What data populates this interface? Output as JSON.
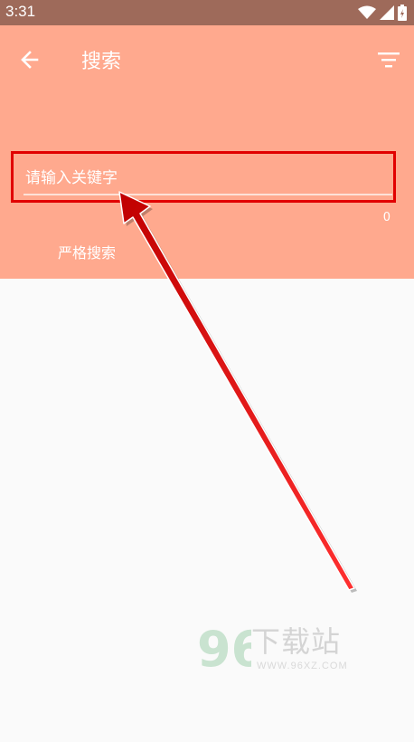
{
  "status_bar": {
    "time": "3:31",
    "icons": [
      "wifi-icon",
      "signal-icon",
      "battery-icon"
    ]
  },
  "header": {
    "title": "搜索",
    "back_icon": "arrow-left-icon",
    "filter_icon": "filter-icon"
  },
  "search": {
    "placeholder": "请输入关键字",
    "value": "",
    "char_count": "0",
    "strict_label": "严格搜索"
  },
  "watermark": {
    "logo_text": "96",
    "name": "下载站",
    "url": "WWW.96XZ.COM"
  },
  "colors": {
    "status_bar": "#9e6a5a",
    "header": "#ffa98e",
    "body": "#fafafa",
    "annotation": "#e10000"
  }
}
